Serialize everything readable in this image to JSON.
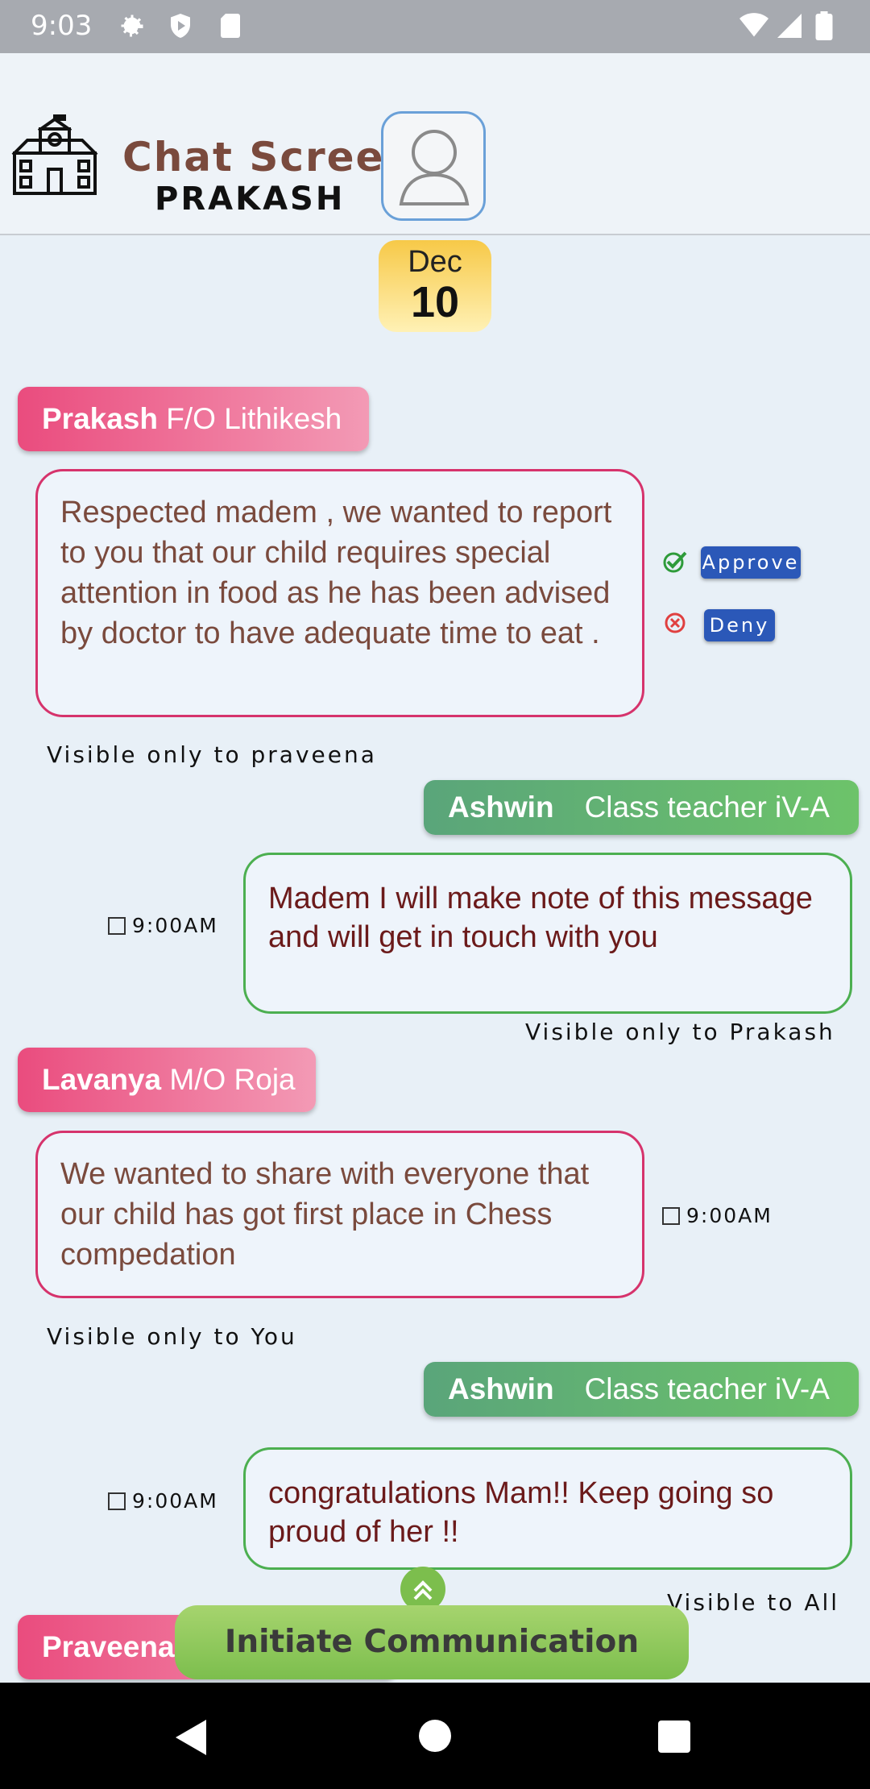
{
  "status_bar": {
    "time": "9:03"
  },
  "header": {
    "title": "Chat Screen",
    "subtitle": "PRAKASH"
  },
  "date_badge": {
    "month": "Dec",
    "day": "10"
  },
  "messages": [
    {
      "sender_name": "Prakash",
      "sender_relation": "F/O Lithikesh",
      "text": "Respected madem , we wanted to report to you that our child requires special attention in food as he has been advised by doctor to have adequate time to eat .",
      "visibility": "Visible only to praveena",
      "approve_label": "Approve",
      "deny_label": "Deny"
    },
    {
      "sender_name": "Ashwin",
      "sender_role": "Class teacher iV-A",
      "text": " Madem I will make note of this message and will get in touch with you",
      "time": "9:00AM",
      "visibility": "Visible only to Prakash"
    },
    {
      "sender_name": "Lavanya",
      "sender_relation": "M/O Roja",
      "text": "We wanted to share with everyone that our child has got first place in Chess compedation",
      "time": "9:00AM",
      "visibility": "Visible only to You"
    },
    {
      "sender_name": "Ashwin",
      "sender_role": "Class teacher iV-A",
      "text": " congratulations Mam!!  Keep going so proud of her !!",
      "time": "9:00AM",
      "visibility": "Visible to All"
    },
    {
      "sender_name": "Praveena"
    }
  ],
  "initiate_button": {
    "label": "Initiate Communication"
  },
  "colors": {
    "pink": "#d6336c",
    "green": "#4caf50",
    "title_brown": "#7a4a3d",
    "approve_blue": "#2b58b8"
  },
  "icons": [
    "settings-icon",
    "shield-icon",
    "sd-card-icon",
    "wifi-icon",
    "signal-icon",
    "battery-icon",
    "school-icon",
    "avatar-icon",
    "check-icon",
    "cancel-icon",
    "clock-icon",
    "chevron-up-icon",
    "back-icon",
    "home-icon",
    "recents-icon"
  ]
}
